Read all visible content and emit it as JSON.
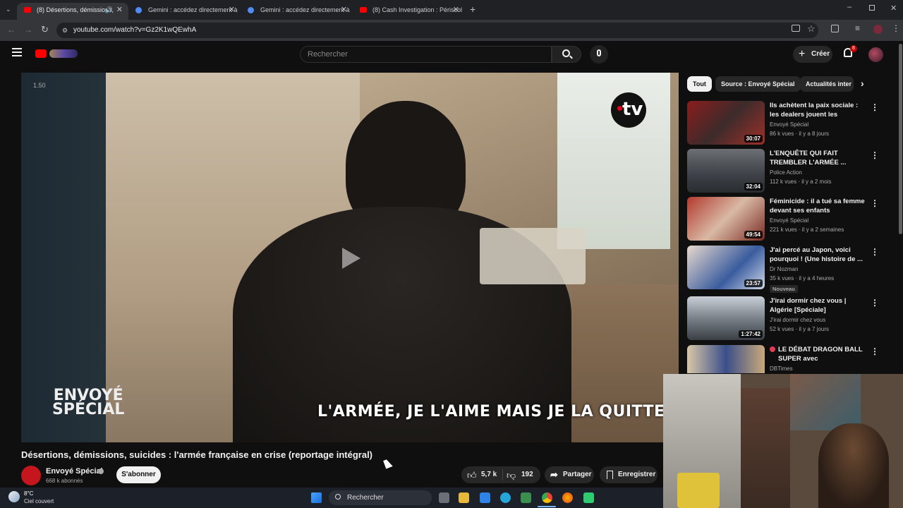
{
  "browser": {
    "tabs": [
      {
        "title": "(8) Désertions, démissions,",
        "active": true
      },
      {
        "title": "Gemini : accédez directement à",
        "active": false
      },
      {
        "title": "Gemini : accédez directement à",
        "active": false
      },
      {
        "title": "(8) Cash Investigation : Périscol",
        "active": false
      }
    ],
    "url": "youtube.com/watch?v=Gz2K1wQEwhA"
  },
  "header": {
    "search_placeholder": "Rechercher",
    "create_label": "Créer",
    "notifications_count": "8"
  },
  "video": {
    "timecode": "1.50",
    "watermark": "tv",
    "subtitle": "L'ARMÉE, JE L'AIME MAIS JE LA QUITTE",
    "brand_line1": "ENVOYÉ",
    "brand_line2": "SPÉCIAL",
    "title": "Désertions, démissions, suicides : l'armée française en crise (reportage intégral)",
    "channel": "Envoyé Spécial",
    "subscribers": "668 k abonnés",
    "subscribe_label": "S'abonner",
    "likes": "5,7 k",
    "dislikes": "192",
    "share_label": "Partager",
    "save_label": "Enregistrer"
  },
  "chips": [
    "Tout",
    "Source : Envoyé Spécial",
    "Actualités inter"
  ],
  "recommendations": [
    {
      "title": "Ils achètent la paix sociale : les dealers jouent les bienfaiteurs",
      "channel": "Envoyé Spécial",
      "meta": "86 k vues · il y a 8 jours",
      "duration": "30:07"
    },
    {
      "title": "L'ENQUÊTE QUI FAIT TREMBLER L'ARMÉE ...",
      "channel": "Police Action",
      "meta": "112 k vues · il y a 2 mois",
      "duration": "32:04"
    },
    {
      "title": "Féminicide : il a tué sa femme devant ses enfants (reportage ...",
      "channel": "Envoyé Spécial",
      "meta": "221 k vues · il y a 2 semaines",
      "duration": "49:54"
    },
    {
      "title": "J'ai percé au Japon, voici pourquoi ! (Une histoire de ...",
      "channel": "Dr Nozman",
      "meta": "35 k vues · il y a 4 heures",
      "duration": "23:57",
      "badge": "Nouveau"
    },
    {
      "title": "J'irai dormir chez vous | Algérie [Spéciale]",
      "channel": "J'irai dormir chez vous",
      "meta": "52 k vues · il y a 7 jours",
      "duration": "1:27:42"
    },
    {
      "title": "LE DÉBAT DRAGON BALL SUPER avec @SofianLeGEEK ...",
      "channel": "DBTimes",
      "meta": "",
      "duration": ""
    }
  ],
  "taskbar": {
    "temperature": "8°C",
    "weather": "Ciel couvert",
    "search_label": "Rechercher"
  }
}
